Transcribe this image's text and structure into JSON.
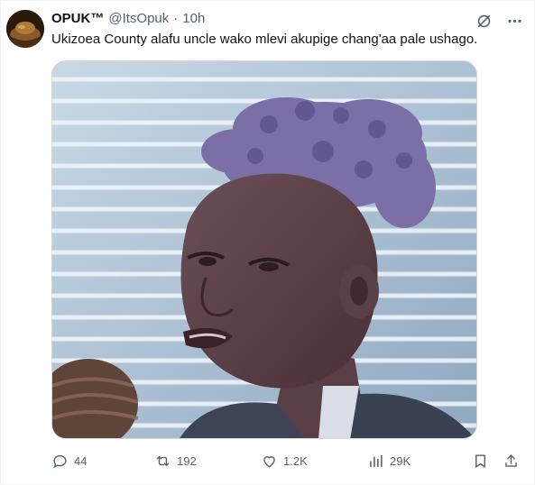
{
  "tweet": {
    "author": {
      "name": "OPUK™",
      "handle": "@ItsOpuk",
      "separator": "·",
      "time": "10h"
    },
    "text": "Ukizoea County alafu uncle wako mlevi akupige chang'aa pale ushago.",
    "media": {
      "alt": ""
    },
    "icons": {
      "grok": "grok-slash-circle-icon",
      "more": "more-dots-icon"
    }
  },
  "actions": {
    "replies": "44",
    "retweets": "192",
    "likes": "1.2K",
    "views": "29K"
  },
  "colors": {
    "text": "#0f1419",
    "muted": "#536471",
    "border": "#cfd9de"
  }
}
